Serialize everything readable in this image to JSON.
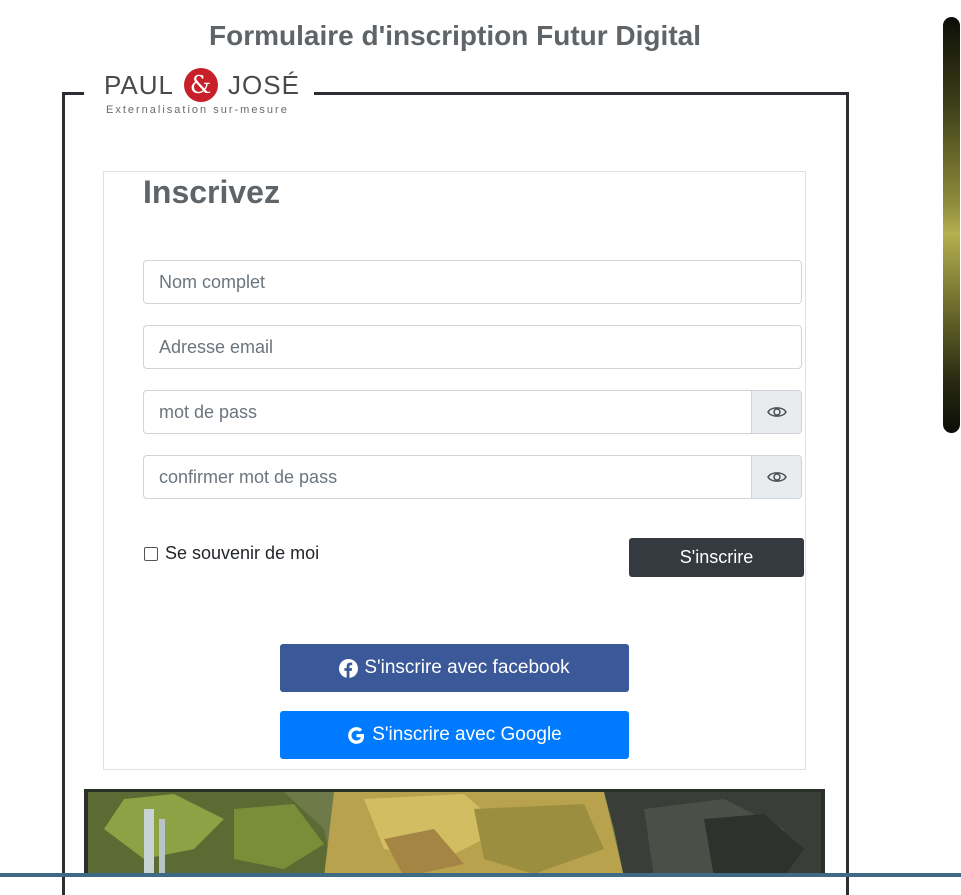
{
  "page": {
    "title": "Formulaire d'inscription Futur Digital"
  },
  "logo": {
    "left_word": "PAUL",
    "ampersand": "&",
    "right_word": "JOSÉ",
    "tagline": "Externalisation sur-mesure",
    "accent_color": "#c8202a"
  },
  "form": {
    "heading": "Inscrivez",
    "fields": {
      "full_name": {
        "placeholder": "Nom complet",
        "value": ""
      },
      "email": {
        "placeholder": "Adresse email",
        "value": ""
      },
      "password": {
        "placeholder": "mot de pass",
        "value": "",
        "toggle_icon": "eye-icon"
      },
      "confirm_password": {
        "placeholder": "confirmer mot de pass",
        "value": "",
        "toggle_icon": "eye-icon"
      }
    },
    "remember_label": "Se souvenir de moi",
    "remember_checked": false,
    "submit_label": "S'inscrire"
  },
  "social": {
    "facebook": {
      "label": "S'inscrire avec facebook",
      "icon": "facebook-icon",
      "color": "#3b5998"
    },
    "google": {
      "label": "S'inscrire avec Google",
      "icon": "google-icon",
      "color": "#007bff"
    }
  },
  "colors": {
    "submit_bg": "#343a40",
    "title_color": "#5f6468"
  }
}
